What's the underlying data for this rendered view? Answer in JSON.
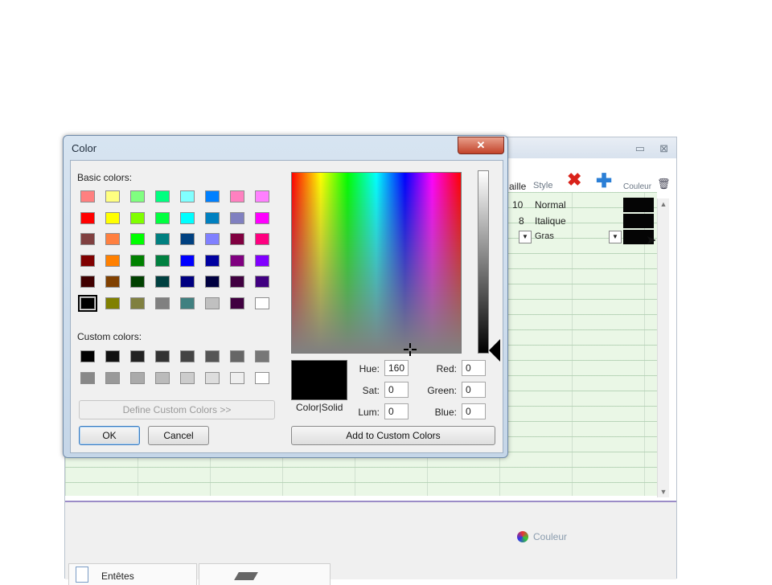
{
  "background_app": {
    "columns": {
      "taille": "aille",
      "style": "Style",
      "couleur": "Couleur"
    },
    "rows": [
      {
        "size": "10",
        "style": "Normal"
      },
      {
        "size": "8",
        "style": "Italique"
      },
      {
        "size": "",
        "style": "Gras"
      }
    ],
    "couleur_button": "Couleur",
    "tab_label": "Entêtes"
  },
  "dialog": {
    "title": "Color",
    "close_glyph": "✕",
    "basic_colors_label": "Basic colors:",
    "custom_colors_label": "Custom colors:",
    "basic_colors": [
      "#ff8080",
      "#ffff80",
      "#80ff80",
      "#00ff80",
      "#80ffff",
      "#0080ff",
      "#ff80c0",
      "#ff80ff",
      "#ff0000",
      "#ffff00",
      "#80ff00",
      "#00ff40",
      "#00ffff",
      "#0080c0",
      "#8080c0",
      "#ff00ff",
      "#804040",
      "#ff8040",
      "#00ff00",
      "#008080",
      "#004080",
      "#8080ff",
      "#800040",
      "#ff0080",
      "#800000",
      "#ff8000",
      "#008000",
      "#008040",
      "#0000ff",
      "#0000a0",
      "#800080",
      "#8000ff",
      "#400000",
      "#804000",
      "#004000",
      "#004040",
      "#000080",
      "#000040",
      "#400040",
      "#400080",
      "#000000",
      "#808000",
      "#808040",
      "#808080",
      "#408080",
      "#c0c0c0",
      "#400040",
      "#ffffff"
    ],
    "custom_colors": [
      "#000000",
      "#111111",
      "#222222",
      "#333333",
      "#444444",
      "#555555",
      "#666666",
      "#777777",
      "#888888",
      "#999999",
      "#aaaaaa",
      "#bbbbbb",
      "#cccccc",
      "#dddddd",
      "#eeeeee",
      "#ffffff"
    ],
    "define_custom_button": "Define Custom Colors >>",
    "ok_button": "OK",
    "cancel_button": "Cancel",
    "color_solid_label": "Color|Solid",
    "hue_label": "Hue:",
    "sat_label": "Sat:",
    "lum_label": "Lum:",
    "red_label": "Red:",
    "green_label": "Green:",
    "blue_label": "Blue:",
    "hue": "160",
    "sat": "0",
    "lum": "0",
    "red": "0",
    "green": "0",
    "blue": "0",
    "add_custom_button": "Add to Custom Colors"
  }
}
